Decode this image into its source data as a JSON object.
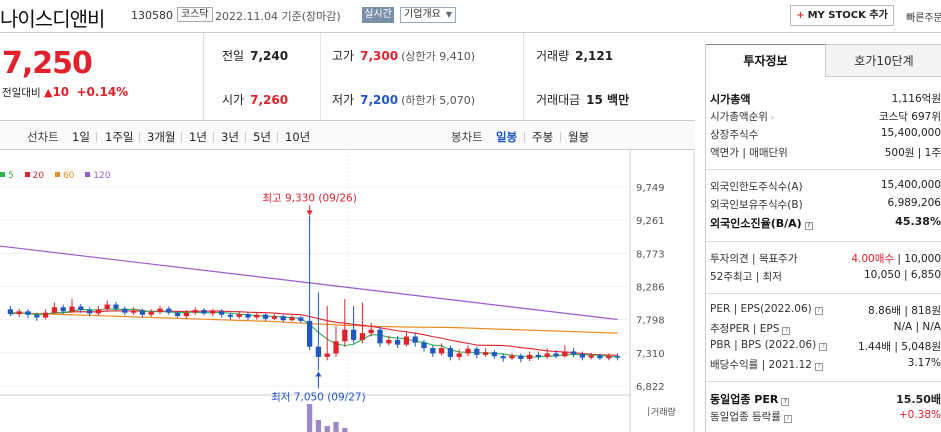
{
  "header": {
    "company_name": "나이스디앤비",
    "code": "130580",
    "market": "코스닥",
    "as_of": "2022.11.04  기준(장마감)",
    "live_label": "실시간",
    "overview_label": "기업개요",
    "mystock_label": "MY STOCK 추가",
    "quick_label": "빠른주문"
  },
  "price": {
    "current": "7,250",
    "change_label": "전일대비",
    "change_value": "10",
    "change_pct": "+0.14%"
  },
  "quote": {
    "prev_label": "전일",
    "prev": "7,240",
    "high_label": "고가",
    "high": "7,300",
    "upper_limit": "(상한가 9,410)",
    "volume_label": "거래량",
    "volume": "2,121",
    "open_label": "시가",
    "open": "7,260",
    "low_label": "저가",
    "low": "7,200",
    "lower_limit": "(하한가 5,070)",
    "amount_label": "거래대금",
    "amount": "15 백만"
  },
  "chart_toolbar": {
    "line_label": "선차트",
    "periods": [
      "1일",
      "1주일",
      "3개월",
      "1년",
      "3년",
      "5년",
      "10년"
    ],
    "candle_label": "봉차트",
    "candle_periods": [
      "일봉",
      "주봉",
      "월봉"
    ],
    "active_candle": "일봉"
  },
  "chart_data": {
    "type": "candlestick",
    "title": "",
    "y_ticks": [
      "9,749",
      "9,261",
      "8,773",
      "8,286",
      "7,798",
      "7,310",
      "6,822"
    ],
    "ylim": [
      6822,
      9749
    ],
    "legend": [
      {
        "name": "5",
        "color": "#2bb24c"
      },
      {
        "name": "20",
        "color": "#e3212d"
      },
      {
        "name": "60",
        "color": "#f08a24"
      },
      {
        "name": "120",
        "color": "#9b59d0"
      }
    ],
    "annotation_high": "최고 9,330 (09/26)",
    "annotation_low": "최저 7,050 (09/27)",
    "volume_label": "거래량",
    "candles": [
      {
        "o": 7950,
        "c": 7880,
        "h": 8000,
        "l": 7850
      },
      {
        "o": 7880,
        "c": 7920,
        "h": 7960,
        "l": 7840
      },
      {
        "o": 7920,
        "c": 7870,
        "h": 7950,
        "l": 7820
      },
      {
        "o": 7870,
        "c": 7830,
        "h": 7900,
        "l": 7780
      },
      {
        "o": 7830,
        "c": 7900,
        "h": 7950,
        "l": 7800
      },
      {
        "o": 7900,
        "c": 7980,
        "h": 8050,
        "l": 7880
      },
      {
        "o": 7980,
        "c": 7920,
        "h": 8020,
        "l": 7880
      },
      {
        "o": 7920,
        "c": 7990,
        "h": 8100,
        "l": 7900
      },
      {
        "o": 7990,
        "c": 7940,
        "h": 8030,
        "l": 7900
      },
      {
        "o": 7940,
        "c": 7890,
        "h": 7980,
        "l": 7850
      },
      {
        "o": 7890,
        "c": 7950,
        "h": 8000,
        "l": 7860
      },
      {
        "o": 7950,
        "c": 8020,
        "h": 8080,
        "l": 7920
      },
      {
        "o": 8020,
        "c": 7960,
        "h": 8060,
        "l": 7930
      },
      {
        "o": 7960,
        "c": 7900,
        "h": 7990,
        "l": 7860
      },
      {
        "o": 7900,
        "c": 7930,
        "h": 7980,
        "l": 7870
      },
      {
        "o": 7930,
        "c": 7870,
        "h": 7960,
        "l": 7830
      },
      {
        "o": 7870,
        "c": 7910,
        "h": 7950,
        "l": 7840
      },
      {
        "o": 7910,
        "c": 7960,
        "h": 8000,
        "l": 7880
      },
      {
        "o": 7960,
        "c": 7900,
        "h": 7990,
        "l": 7870
      },
      {
        "o": 7900,
        "c": 7850,
        "h": 7930,
        "l": 7820
      },
      {
        "o": 7850,
        "c": 7900,
        "h": 7940,
        "l": 7810
      },
      {
        "o": 7900,
        "c": 7940,
        "h": 7980,
        "l": 7870
      },
      {
        "o": 7940,
        "c": 7890,
        "h": 7970,
        "l": 7860
      },
      {
        "o": 7890,
        "c": 7920,
        "h": 7960,
        "l": 7850
      },
      {
        "o": 7920,
        "c": 7870,
        "h": 7950,
        "l": 7830
      },
      {
        "o": 7870,
        "c": 7840,
        "h": 7900,
        "l": 7800
      },
      {
        "o": 7840,
        "c": 7880,
        "h": 7920,
        "l": 7810
      },
      {
        "o": 7880,
        "c": 7830,
        "h": 7910,
        "l": 7790
      },
      {
        "o": 7830,
        "c": 7870,
        "h": 7900,
        "l": 7800
      },
      {
        "o": 7870,
        "c": 7810,
        "h": 7890,
        "l": 7780
      },
      {
        "o": 7810,
        "c": 7850,
        "h": 7880,
        "l": 7790
      },
      {
        "o": 7850,
        "c": 7790,
        "h": 7870,
        "l": 7760
      },
      {
        "o": 7790,
        "c": 7830,
        "h": 7860,
        "l": 7770
      },
      {
        "o": 7830,
        "c": 7780,
        "h": 7850,
        "l": 7750
      },
      {
        "o": 7780,
        "c": 7400,
        "h": 9330,
        "l": 7350
      },
      {
        "o": 7400,
        "c": 7250,
        "h": 8200,
        "l": 7050
      },
      {
        "o": 7250,
        "c": 7300,
        "h": 8000,
        "l": 7200
      },
      {
        "o": 7300,
        "c": 7480,
        "h": 7700,
        "l": 7250
      },
      {
        "o": 7480,
        "c": 7650,
        "h": 8100,
        "l": 7400
      },
      {
        "o": 7650,
        "c": 7500,
        "h": 8000,
        "l": 7450
      },
      {
        "o": 7500,
        "c": 7600,
        "h": 8050,
        "l": 7450
      },
      {
        "o": 7600,
        "c": 7650,
        "h": 7750,
        "l": 7550
      },
      {
        "o": 7650,
        "c": 7450,
        "h": 7700,
        "l": 7400
      },
      {
        "o": 7450,
        "c": 7500,
        "h": 7560,
        "l": 7420
      },
      {
        "o": 7500,
        "c": 7430,
        "h": 7560,
        "l": 7380
      },
      {
        "o": 7430,
        "c": 7550,
        "h": 7620,
        "l": 7400
      },
      {
        "o": 7550,
        "c": 7460,
        "h": 7600,
        "l": 7400
      },
      {
        "o": 7460,
        "c": 7380,
        "h": 7500,
        "l": 7330
      },
      {
        "o": 7380,
        "c": 7300,
        "h": 7420,
        "l": 7250
      },
      {
        "o": 7300,
        "c": 7380,
        "h": 7450,
        "l": 7270
      },
      {
        "o": 7380,
        "c": 7250,
        "h": 7420,
        "l": 7200
      },
      {
        "o": 7250,
        "c": 7300,
        "h": 7360,
        "l": 7200
      },
      {
        "o": 7300,
        "c": 7370,
        "h": 7420,
        "l": 7260
      },
      {
        "o": 7370,
        "c": 7280,
        "h": 7400,
        "l": 7230
      },
      {
        "o": 7280,
        "c": 7320,
        "h": 7380,
        "l": 7250
      },
      {
        "o": 7320,
        "c": 7260,
        "h": 7350,
        "l": 7220
      },
      {
        "o": 7260,
        "c": 7230,
        "h": 7300,
        "l": 7180
      },
      {
        "o": 7230,
        "c": 7270,
        "h": 7310,
        "l": 7200
      },
      {
        "o": 7270,
        "c": 7220,
        "h": 7300,
        "l": 7170
      },
      {
        "o": 7220,
        "c": 7280,
        "h": 7330,
        "l": 7190
      },
      {
        "o": 7280,
        "c": 7250,
        "h": 7330,
        "l": 7210
      },
      {
        "o": 7250,
        "c": 7300,
        "h": 7380,
        "l": 7220
      },
      {
        "o": 7300,
        "c": 7260,
        "h": 7350,
        "l": 7230
      },
      {
        "o": 7260,
        "c": 7330,
        "h": 7420,
        "l": 7240
      },
      {
        "o": 7330,
        "c": 7290,
        "h": 7380,
        "l": 7250
      },
      {
        "o": 7290,
        "c": 7240,
        "h": 7330,
        "l": 7200
      },
      {
        "o": 7240,
        "c": 7270,
        "h": 7310,
        "l": 7210
      },
      {
        "o": 7270,
        "c": 7230,
        "h": 7300,
        "l": 7200
      },
      {
        "o": 7230,
        "c": 7260,
        "h": 7300,
        "l": 7200
      },
      {
        "o": 7260,
        "c": 7250,
        "h": 7300,
        "l": 7200
      }
    ],
    "ma120": [
      8880,
      7800
    ],
    "ma60": [
      7900,
      7600
    ]
  },
  "right_panel": {
    "tab_active": "투자정보",
    "tab_other": "호가10단계",
    "rows": [
      {
        "k": "시가총액",
        "v": "1,116억원"
      },
      {
        "k": "시가총액순위",
        "v": "코스닥 697위"
      },
      {
        "k": "상장주식수",
        "v": "15,400,000"
      },
      {
        "k": "액면가 | 매매단위",
        "v": "500원 | 1주"
      },
      {
        "k": "외국인한도주식수(A)",
        "v": "15,400,000"
      },
      {
        "k": "외국인보유주식수(B)",
        "v": "6,989,206"
      },
      {
        "k": "외국인소진율(B/A)",
        "v": "45.38%"
      },
      {
        "k": "투자의견 | 목표주가",
        "v_red": "4.00매수",
        "v": " | 10,000"
      },
      {
        "k": "52주최고 | 최저",
        "v": "10,050 | 6,850"
      },
      {
        "k": "PER | EPS(2022.06)",
        "v": "8.86배 | 818원"
      },
      {
        "k": "추정PER | EPS",
        "v": "N/A | N/A"
      },
      {
        "k": "PBR | BPS (2022.06)",
        "v": "1.44배 | 5,048원"
      },
      {
        "k": "배당수익률 | 2021.12",
        "v": "3.17%"
      },
      {
        "k": "동일업종 PER",
        "v": "15.50배"
      },
      {
        "k": "동일업종 등락률",
        "v": "+0.38%"
      }
    ]
  }
}
